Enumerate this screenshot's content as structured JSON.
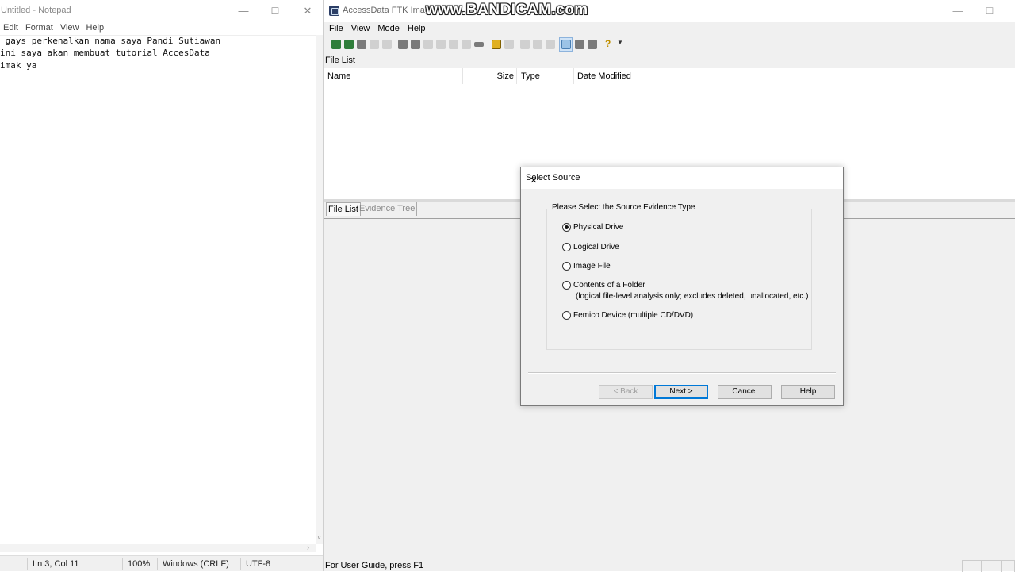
{
  "notepad": {
    "title": "Untitled - Notepad",
    "menu": [
      "Edit",
      "Format",
      "View",
      "Help"
    ],
    "lines": [
      " gays perkenalkan nama saya Pandi Sutiawan",
      "ini saya akan membuat tutorial AccesData",
      "imak ya"
    ],
    "status": {
      "position": "Ln 3, Col 11",
      "zoom": "100%",
      "line_ending": "Windows (CRLF)",
      "encoding": "UTF-8"
    }
  },
  "ftk": {
    "title": "AccessData FTK Imager",
    "watermark": "www.BANDICAM.com",
    "menu": [
      "File",
      "View",
      "Mode",
      "Help"
    ],
    "file_list_header": "File List",
    "columns": [
      "Name",
      "Size",
      "Type",
      "Date Modified"
    ],
    "tabs": [
      "File List",
      "Evidence Tree"
    ],
    "status_text": "For User Guide, press F1"
  },
  "dialog": {
    "title": "Select Source",
    "group_label": "Please Select the Source Evidence Type",
    "options": [
      "Physical Drive",
      "Logical Drive",
      "Image File",
      "Contents of a Folder",
      "Femico Device (multiple CD/DVD)"
    ],
    "selected_option": "Physical Drive",
    "folder_note": "(logical file-level analysis only; excludes deleted, unallocated, etc.)",
    "buttons": {
      "back": "< Back",
      "next": "Next >",
      "cancel": "Cancel",
      "help": "Help"
    }
  }
}
